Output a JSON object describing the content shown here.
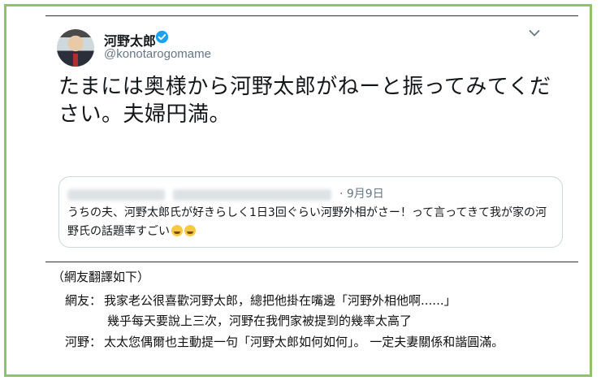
{
  "tweet": {
    "author_name": "河野太郎",
    "handle": "@konotarogomame",
    "text": "たまには奥様から河野太郎がねーと振ってみてください。夫婦円満。",
    "quote": {
      "date": "· 9月9日",
      "text": "うちの夫、河野太郎氏が好きらしく1日3回ぐらい河野外相がさー！って言ってきて我が家の河野氏の話題率すごい"
    }
  },
  "translation": {
    "heading": "（網友翻譯如下）",
    "line1_speaker": "網友：",
    "line1_text": "我家老公很喜歡河野太郎，總把他掛在嘴邊「河野外相他啊......」",
    "line2_text": "幾乎每天要說上三次，河野在我們家被提到的幾率太高了",
    "line3_speaker": "河野：",
    "line3_text": "太太您偶爾也主動提一句「河野太郎如何如何」。 一定夫妻關係和諧圓滿。"
  },
  "colors": {
    "frame": "#8cc46a",
    "verified": "#1da1f2",
    "secondary_text": "#657786"
  }
}
